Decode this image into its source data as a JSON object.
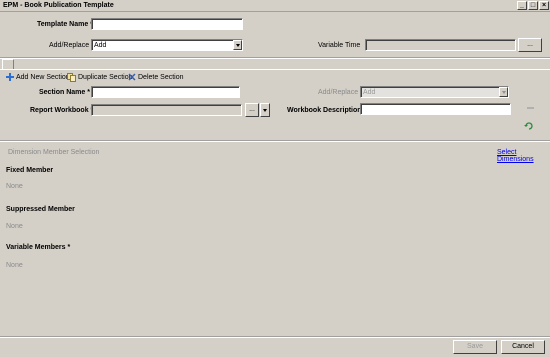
{
  "window": {
    "title": "EPM - Book Publication Template",
    "minimize": "_",
    "maximize": "□",
    "close": "×"
  },
  "template": {
    "name_label": "Template Name *",
    "name_value": "",
    "add_replace_label": "Add/Replace",
    "add_replace_value": "Add",
    "variable_time_label": "Variable Time",
    "variable_time_value": "",
    "browse_label": "..."
  },
  "toolbar": {
    "add_section": "Add New Section",
    "duplicate_section": "Duplicate Section",
    "delete_section": "Delete Section"
  },
  "section": {
    "name_label": "Section Name *",
    "name_value": "",
    "add_replace_label": "Add/Replace",
    "add_replace_value": "Add",
    "report_workbook_label": "Report Workbook *",
    "report_workbook_value": "",
    "browse_label": "...",
    "workbook_description_label": "Workbook Description *",
    "workbook_description_value": ""
  },
  "dimension": {
    "header": "Dimension Member Selection",
    "select_link": "Select Dimensions",
    "fixed_label": "Fixed Member",
    "fixed_value": "None",
    "suppressed_label": "Suppressed Member",
    "suppressed_value": "None",
    "variable_label": "Variable Members *",
    "variable_value": "None"
  },
  "footer": {
    "save_label": "Save",
    "cancel_label": "Cancel"
  }
}
